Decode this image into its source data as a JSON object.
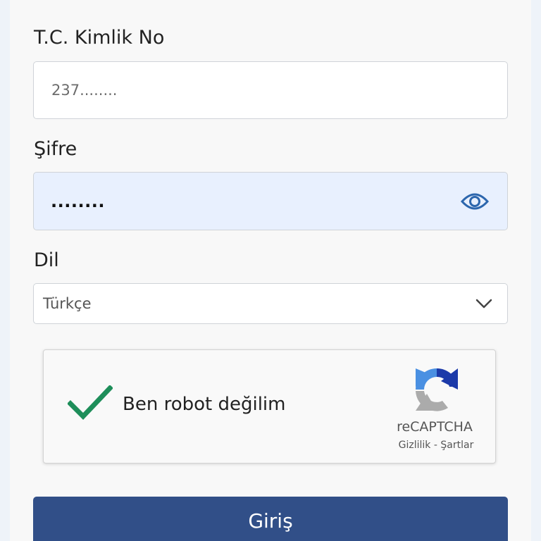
{
  "form": {
    "tc_label": "T.C. Kimlik No",
    "tc_value": "237........",
    "password_label": "Şifre",
    "password_value": "........",
    "language_label": "Dil",
    "language_value": "Türkçe",
    "login_label": "Giriş"
  },
  "captcha": {
    "label": "Ben robot değilim",
    "checked": true,
    "brand": "reCAPTCHA",
    "privacy": "Gizlilik",
    "separator": "-",
    "terms": "Şartlar"
  },
  "icons": {
    "password_toggle": "eye-icon",
    "dropdown": "chevron-down-icon",
    "captcha_check": "checkmark-icon",
    "captcha_logo": "recaptcha-logo"
  },
  "colors": {
    "primary": "#314f88",
    "check": "#1e8e5a",
    "password_bg": "#e8f0fe",
    "eye": "#2c66ad"
  }
}
